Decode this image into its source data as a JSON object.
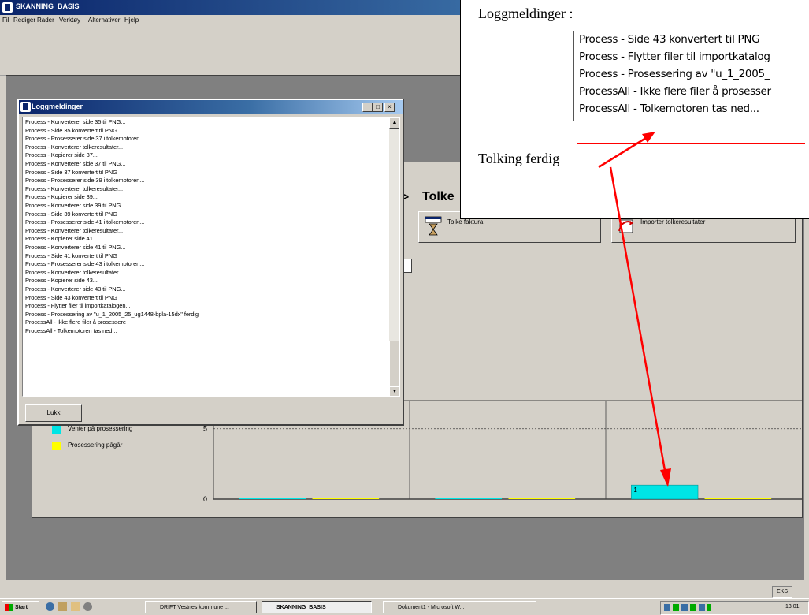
{
  "app": {
    "title": "SKANNING_BASIS",
    "menu": [
      "Fil",
      "Rediger",
      "Rader",
      "Verktøy",
      "Alternativer",
      "Hjelp"
    ]
  },
  "main": {
    "heading": "Tolke",
    "heading_arrow": ">",
    "buttons": {
      "tolke_faktura": "Tolke faktura",
      "importer": "Importer tolkeresultater"
    },
    "legend": [
      {
        "label": "Venter på prosessering",
        "color": "#00e5e5"
      },
      {
        "label": "Prosessering pågår",
        "color": "#ffff00"
      }
    ]
  },
  "chart_data": {
    "type": "bar",
    "categories": [
      "",
      "",
      ""
    ],
    "series": [
      {
        "name": "Venter på prosessering",
        "color": "#00e5e5",
        "values": [
          0,
          0,
          1
        ]
      },
      {
        "name": "Prosessering pågår",
        "color": "#ffff00",
        "values": [
          0,
          0,
          0
        ]
      }
    ],
    "ytick_labels": [
      "0",
      "5"
    ],
    "ylim": [
      0,
      7
    ],
    "data_labels": [
      "1"
    ],
    "grid": true,
    "legend": "left"
  },
  "logwin": {
    "title": "Loggmeldinger",
    "close_label": "Lukk",
    "lines": [
      "Process - Konverterer side 35 til PNG...",
      "Process - Side 35 konvertert til PNG",
      "Process - Prosesserer side 37 i tolkemotoren...",
      "Process - Konverterer tolkeresultater...",
      "Process - Kopierer side 37...",
      "Process - Konverterer side 37 til PNG...",
      "Process - Side 37 konvertert til PNG",
      "Process - Prosesserer side 39 i tolkemotoren...",
      "Process - Konverterer tolkeresultater...",
      "Process - Kopierer side 39...",
      "Process - Konverterer side 39 til PNG...",
      "Process - Side 39 konvertert til PNG",
      "Process - Prosesserer side 41 i tolkemotoren...",
      "Process - Konverterer tolkeresultater...",
      "Process - Kopierer side 41...",
      "Process - Konverterer side 41 til PNG...",
      "Process - Side 41 konvertert til PNG",
      "Process - Prosesserer side 43 i tolkemotoren...",
      "Process - Konverterer tolkeresultater...",
      "Process - Kopierer side 43...",
      "Process - Konverterer side 43 til PNG...",
      "Process - Side 43 konvertert til PNG",
      "Process - Flytter filer til importkatalogen...",
      "Process - Prosessering av \"u_1_2005_25_ug1448-bpla-15dx\" ferdig",
      "ProcessAll - Ikke flere filer å prosessere",
      "ProcessAll - Tolkemotoren tas ned..."
    ]
  },
  "callout": {
    "title": "Loggmeldinger :",
    "lines": [
      "Process - Side 43 konvertert til PNG",
      "Process - Flytter filer til importkatalog",
      "Process - Prosessering av \"u_1_2005_",
      "ProcessAll - Ikke flere filer å prosesser",
      "ProcessAll - Tolkemotoren tas ned..."
    ],
    "note": "Tolking ferdig"
  },
  "statusbar": {
    "right": "EKS"
  },
  "taskbar": {
    "start": "Start",
    "tasks": [
      "DRIFT Vestnes kommune ...",
      "SKANNING_BASIS",
      "Dokument1 - Microsoft W..."
    ],
    "clock": "13:01"
  },
  "colors": {
    "titlebar": "#0a246a",
    "annotation_red": "#ff0000"
  }
}
